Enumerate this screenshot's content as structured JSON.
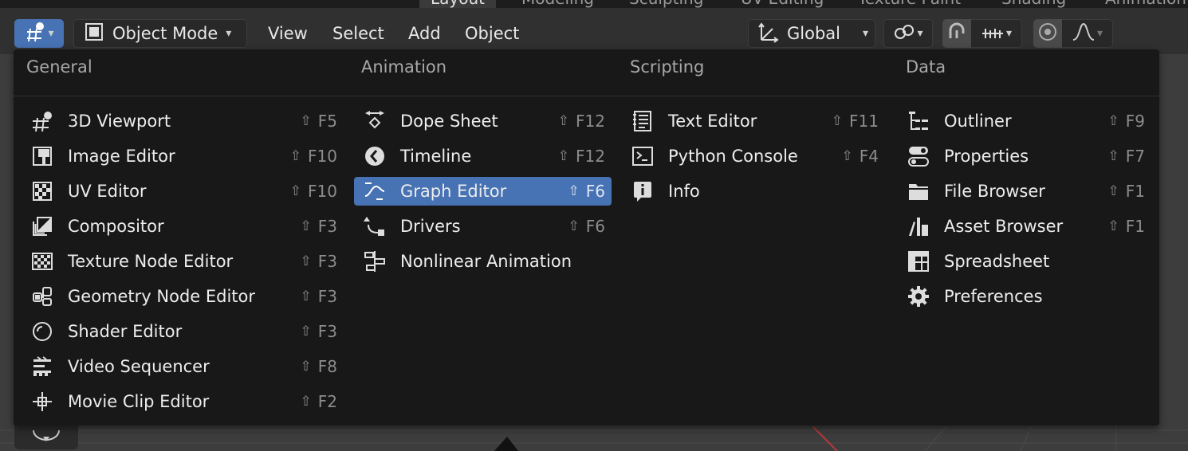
{
  "workspace_tabs": [
    {
      "label": "Layout",
      "active": true
    },
    {
      "label": "Modeling",
      "active": false
    },
    {
      "label": "Sculpting",
      "active": false
    },
    {
      "label": "UV Editing",
      "active": false
    },
    {
      "label": "Texture Paint",
      "active": false
    },
    {
      "label": "Shading",
      "active": false
    },
    {
      "label": "Animation",
      "active": false
    }
  ],
  "header": {
    "mode_label": "Object Mode",
    "menus": [
      "View",
      "Select",
      "Add",
      "Object"
    ],
    "transform_orientation": "Global"
  },
  "menu": {
    "shift_symbol": "⇧",
    "columns": [
      {
        "title": "General",
        "items": [
          {
            "label": "3D Viewport",
            "key": "F5",
            "icon": "viewport-3d-icon"
          },
          {
            "label": "Image Editor",
            "key": "F10",
            "icon": "image-editor-icon"
          },
          {
            "label": "UV Editor",
            "key": "F10",
            "icon": "uv-editor-icon"
          },
          {
            "label": "Compositor",
            "key": "F3",
            "icon": "compositor-icon"
          },
          {
            "label": "Texture Node Editor",
            "key": "F3",
            "icon": "texture-node-icon"
          },
          {
            "label": "Geometry Node Editor",
            "key": "F3",
            "icon": "geometry-node-icon"
          },
          {
            "label": "Shader Editor",
            "key": "F3",
            "icon": "shader-editor-icon"
          },
          {
            "label": "Video Sequencer",
            "key": "F8",
            "icon": "video-sequencer-icon"
          },
          {
            "label": "Movie Clip Editor",
            "key": "F2",
            "icon": "movie-clip-icon"
          }
        ]
      },
      {
        "title": "Animation",
        "items": [
          {
            "label": "Dope Sheet",
            "key": "F12",
            "icon": "dope-sheet-icon"
          },
          {
            "label": "Timeline",
            "key": "F12",
            "icon": "timeline-icon"
          },
          {
            "label": "Graph Editor",
            "key": "F6",
            "icon": "graph-editor-icon",
            "highlight": true
          },
          {
            "label": "Drivers",
            "key": "F6",
            "icon": "drivers-icon"
          },
          {
            "label": "Nonlinear Animation",
            "key": "",
            "icon": "nla-icon"
          }
        ]
      },
      {
        "title": "Scripting",
        "items": [
          {
            "label": "Text Editor",
            "key": "F11",
            "icon": "text-editor-icon"
          },
          {
            "label": "Python Console",
            "key": "F4",
            "icon": "python-console-icon"
          },
          {
            "label": "Info",
            "key": "",
            "icon": "info-icon"
          }
        ]
      },
      {
        "title": "Data",
        "items": [
          {
            "label": "Outliner",
            "key": "F9",
            "icon": "outliner-icon"
          },
          {
            "label": "Properties",
            "key": "F7",
            "icon": "properties-icon"
          },
          {
            "label": "File Browser",
            "key": "F1",
            "icon": "file-browser-icon"
          },
          {
            "label": "Asset Browser",
            "key": "F1",
            "icon": "asset-browser-icon"
          },
          {
            "label": "Spreadsheet",
            "key": "",
            "icon": "spreadsheet-icon"
          },
          {
            "label": "Preferences",
            "key": "",
            "icon": "preferences-icon"
          }
        ]
      }
    ]
  },
  "colors": {
    "accent": "#4772b3",
    "menu_bg": "#181818",
    "header_bg": "#303030",
    "viewport_bg": "#3d3d3d"
  }
}
